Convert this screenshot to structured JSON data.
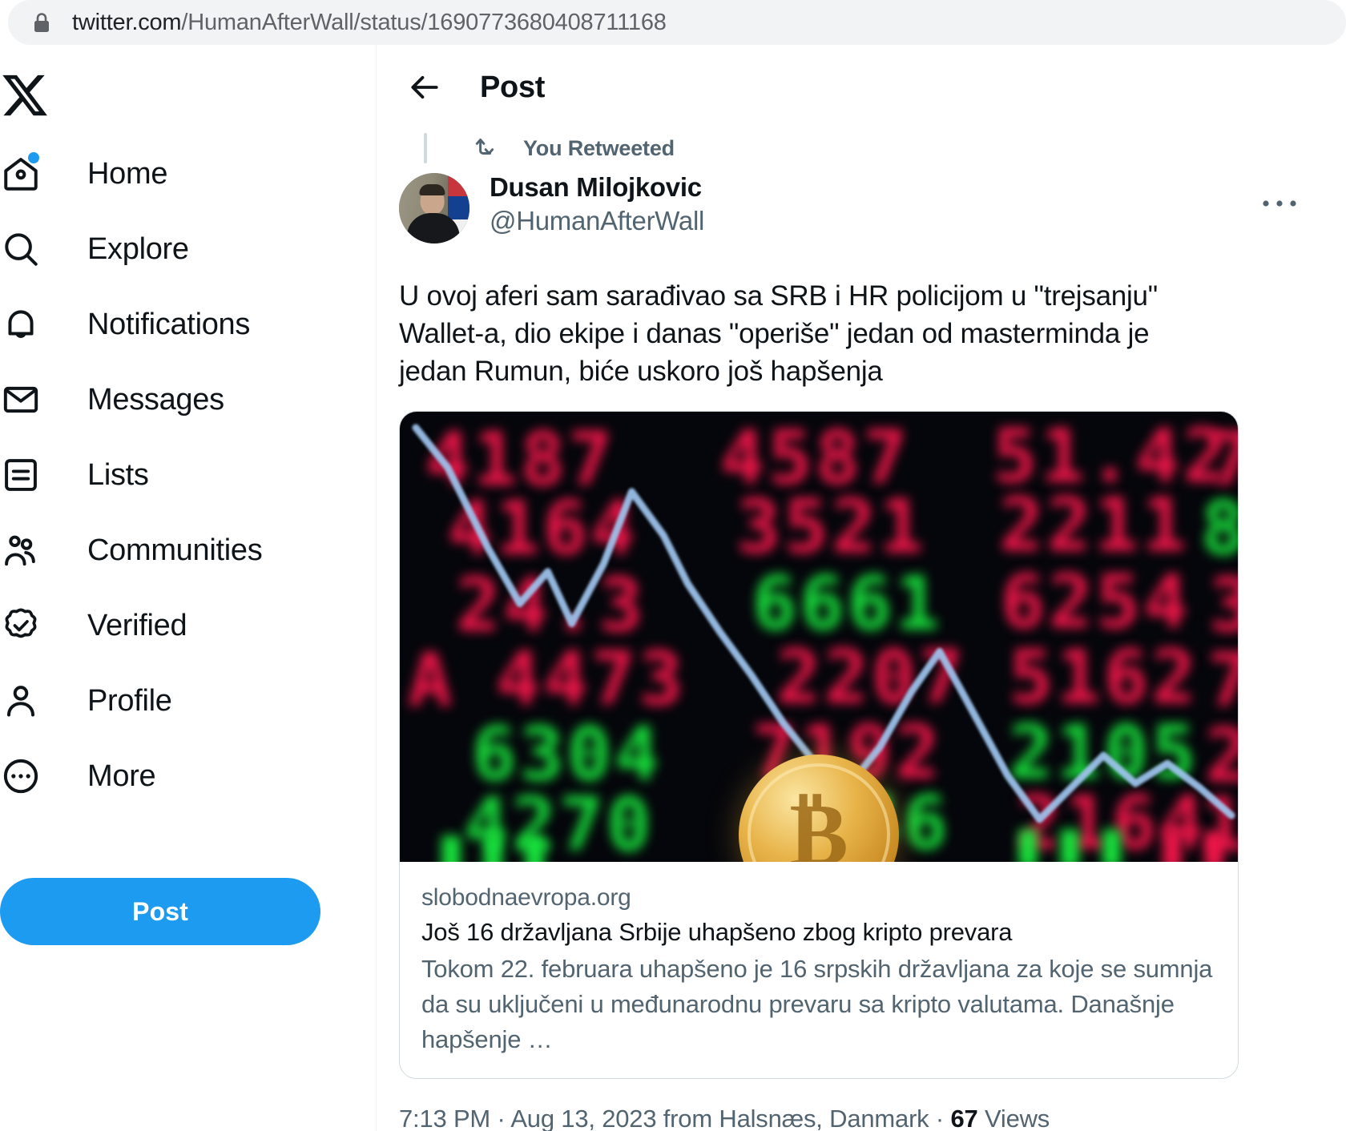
{
  "browser": {
    "lock_icon": "lock-icon",
    "url_host": "twitter.com",
    "url_path": "/HumanAfterWall/status/1690773680408711168"
  },
  "sidebar": {
    "logo_icon": "x-logo-icon",
    "items": [
      {
        "label": "Home",
        "icon": "home-icon",
        "badge": true
      },
      {
        "label": "Explore",
        "icon": "search-icon",
        "badge": false
      },
      {
        "label": "Notifications",
        "icon": "bell-icon",
        "badge": false
      },
      {
        "label": "Messages",
        "icon": "envelope-icon",
        "badge": false
      },
      {
        "label": "Lists",
        "icon": "list-icon",
        "badge": false
      },
      {
        "label": "Communities",
        "icon": "communities-icon",
        "badge": false
      },
      {
        "label": "Verified",
        "icon": "verified-badge-icon",
        "badge": false
      },
      {
        "label": "Profile",
        "icon": "person-icon",
        "badge": false
      },
      {
        "label": "More",
        "icon": "more-circle-icon",
        "badge": false
      }
    ],
    "post_button_label": "Post",
    "post_button_color": "#1d9bf0"
  },
  "main": {
    "back_icon": "back-arrow-icon",
    "header_title": "Post",
    "retweet_icon": "retweet-icon",
    "retweet_label": "You Retweeted",
    "more_icon": "more-horizontal-icon",
    "author": {
      "avatar": "avatar",
      "display_name": "Dusan Milojkovic",
      "handle": "@HumanAfterWall"
    },
    "tweet_text": "U ovoj aferi sam sarađivao sa SRB i HR policijom u \"trejsanju\" Wallet-a, dio ekipe i danas \"operiše\" jedan od masterminda je jedan Rumun, biće uskoro još hapšenja",
    "card": {
      "media_alt": "blurred-stock-ticker-with-bitcoin-coin",
      "domain": "slobodnaevropa.org",
      "title": "Još 16 državljana Srbije uhapšeno zbog kripto prevara",
      "description": "Tokom 22. februara uhapšeno je 16 srpskih državljana za koje se sumnja da su uključeni u međunarodnu prevaru sa kripto valutama. Današnje hapšenje …"
    },
    "meta": {
      "time": "7:13 PM",
      "sep1": " · ",
      "date": "Aug 13, 2023",
      "location": " from Halsnæs, Danmark",
      "sep2": " · ",
      "views_count": "67",
      "views_label": " Views"
    }
  },
  "colors": {
    "accent": "#1d9bf0",
    "text_primary": "#0f1419",
    "text_secondary": "#536471",
    "border": "#cfd9de",
    "ticker_red": "#f2164a",
    "ticker_green": "#18e23c"
  }
}
